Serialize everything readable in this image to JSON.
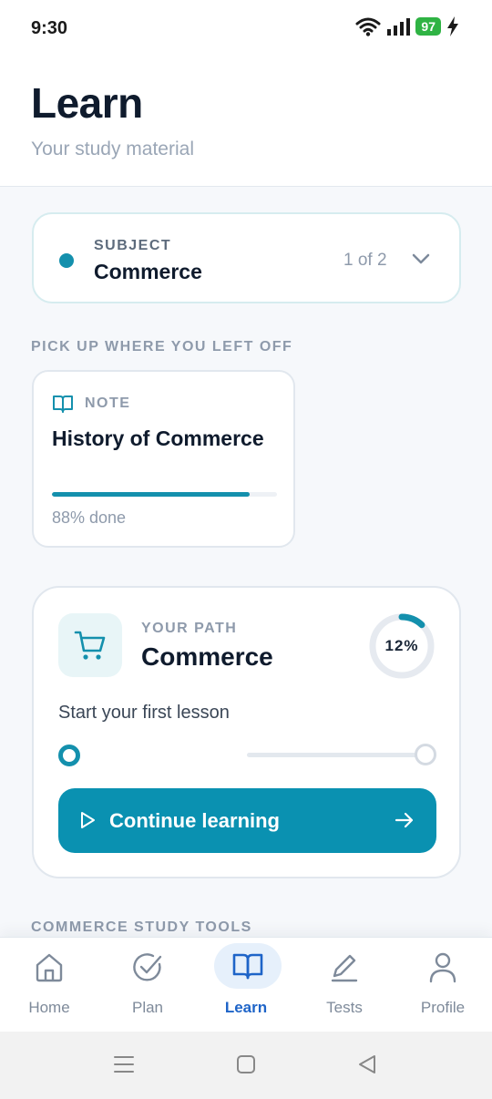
{
  "status": {
    "time": "9:30",
    "battery": "97"
  },
  "header": {
    "title": "Learn",
    "subtitle": "Your study material"
  },
  "subject": {
    "label": "SUBJECT",
    "name": "Commerce",
    "count": "1 of 2",
    "dot_color": "#1490ad"
  },
  "resume": {
    "section_label": "PICK UP WHERE YOU LEFT OFF",
    "note": {
      "kind": "NOTE",
      "title": "History of Commerce",
      "progress": 0.88,
      "progress_text": "88% done"
    }
  },
  "path": {
    "label": "YOUR PATH",
    "name": "Commerce",
    "percent": 12,
    "percent_text": "12%",
    "lesson_text": "Start your first lesson",
    "button_label": "Continue learning",
    "accent": "#0a91b1"
  },
  "tools": {
    "section_label": "COMMERCE STUDY TOOLS"
  },
  "nav": {
    "items": [
      {
        "label": "Home",
        "icon": "home-icon"
      },
      {
        "label": "Plan",
        "icon": "check-circle-icon"
      },
      {
        "label": "Learn",
        "icon": "book-open-icon",
        "active": true
      },
      {
        "label": "Tests",
        "icon": "pencil-icon"
      },
      {
        "label": "Profile",
        "icon": "user-icon"
      }
    ],
    "active_color": "#1e64c8"
  }
}
